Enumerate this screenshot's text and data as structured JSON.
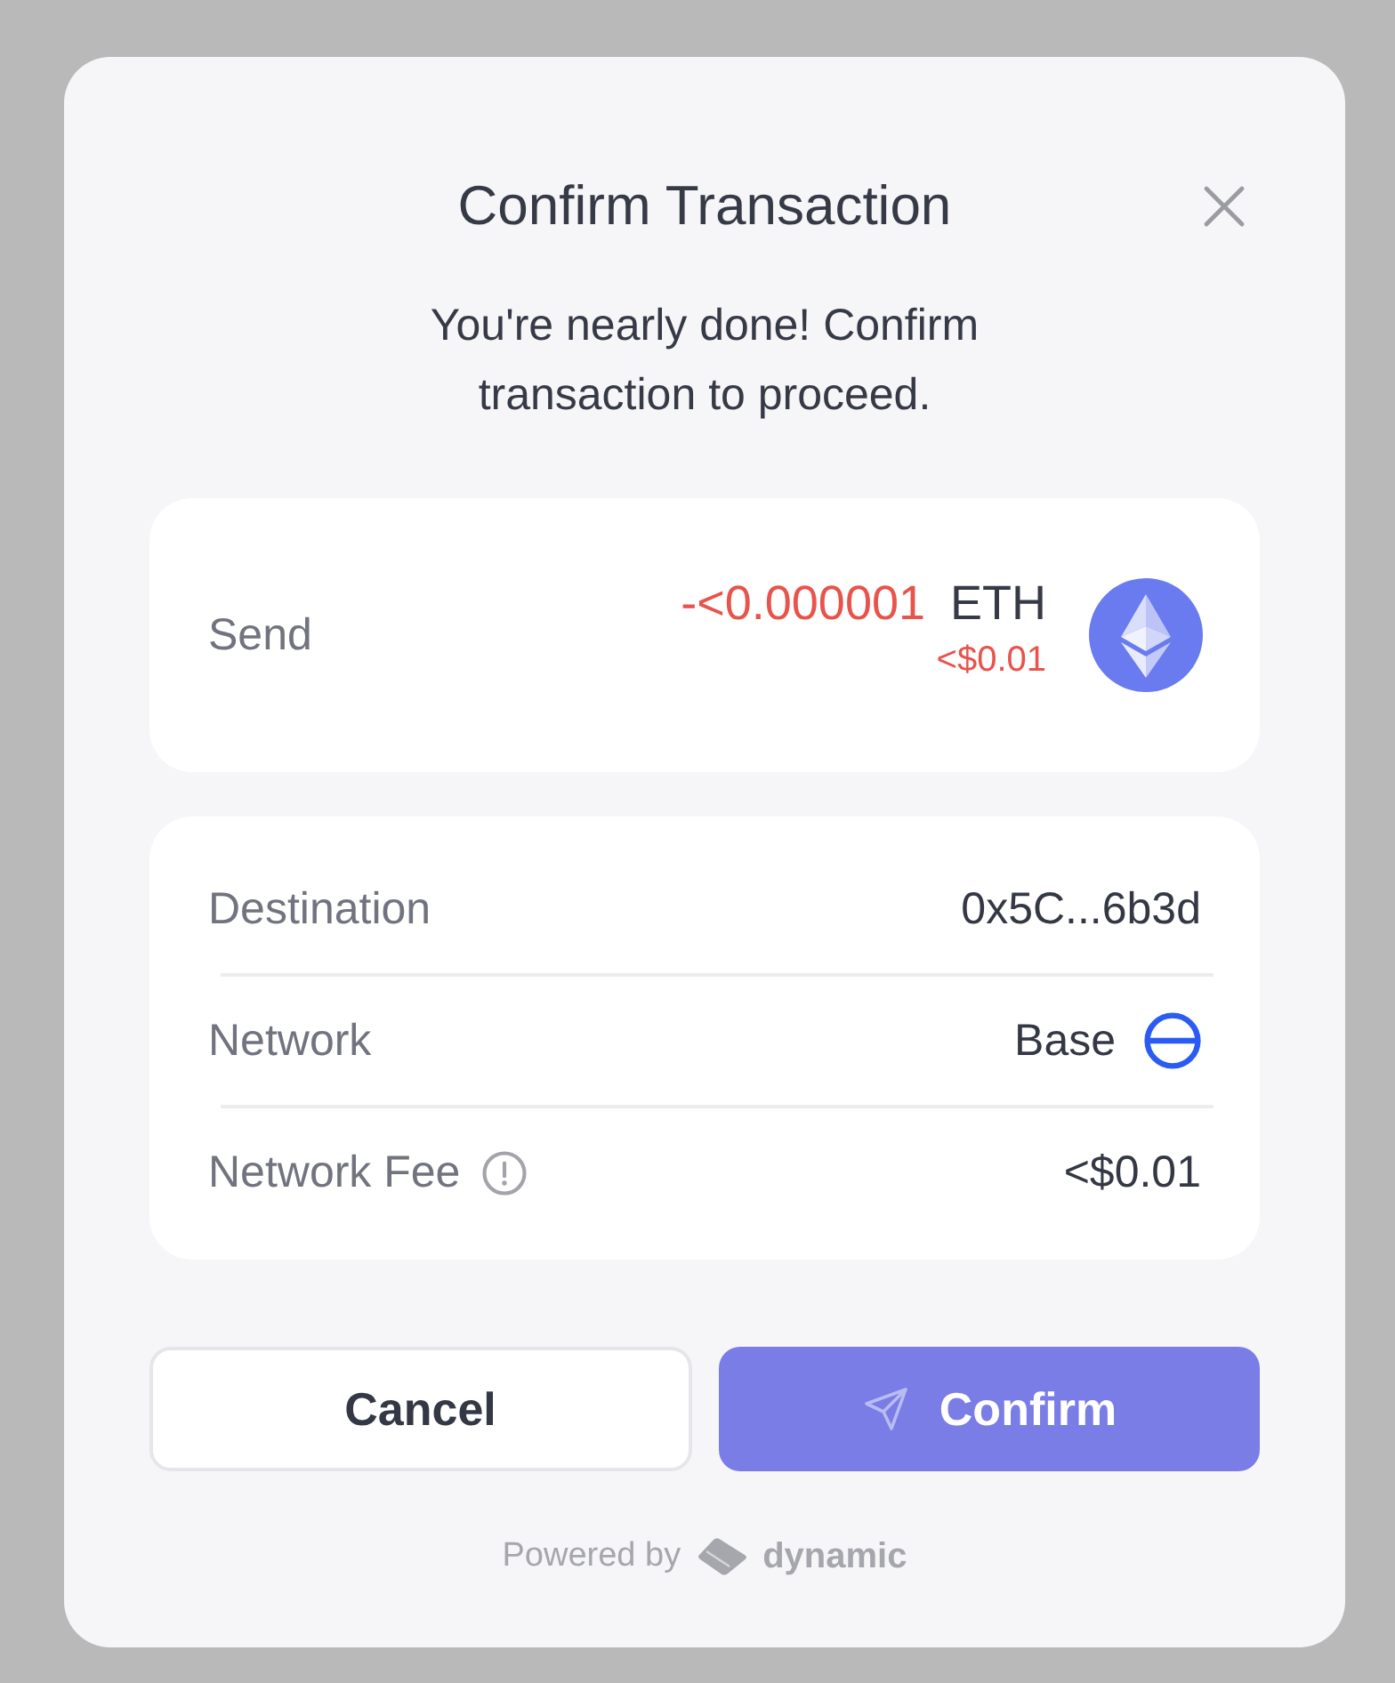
{
  "dialog": {
    "title": "Confirm Transaction",
    "subtitle": "You're nearly done! Confirm transaction to proceed."
  },
  "send": {
    "label": "Send",
    "amount": "-<0.000001",
    "token": "ETH",
    "fiat": "<$0.01"
  },
  "details": [
    {
      "label": "Destination",
      "value": "0x5C...6b3d",
      "kind": "plain"
    },
    {
      "label": "Network",
      "value": "Base",
      "kind": "network"
    },
    {
      "label": "Network Fee",
      "value": "<$0.01",
      "kind": "info"
    }
  ],
  "buttons": [
    {
      "label": "Cancel",
      "kind": "secondary"
    },
    {
      "label": "Confirm",
      "kind": "primary"
    }
  ],
  "footer": {
    "prefix": "Powered by",
    "brand": "dynamic"
  }
}
